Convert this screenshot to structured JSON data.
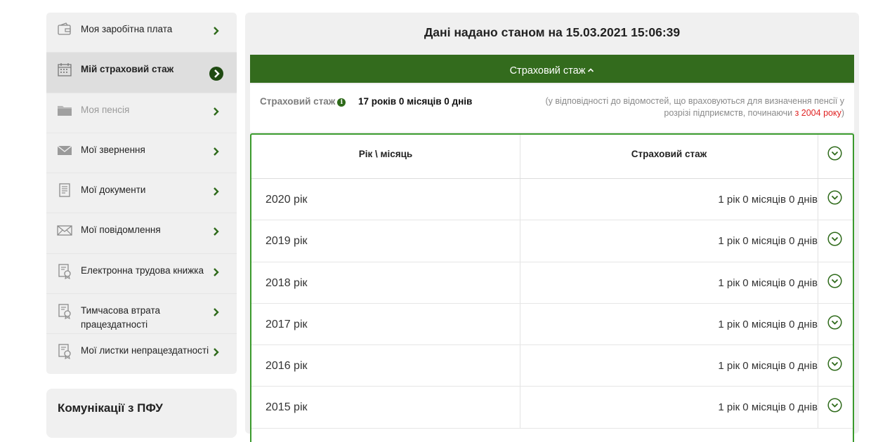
{
  "sidebar": {
    "items": [
      {
        "label": "Моя заробітна плата",
        "icon": "wallet-icon"
      },
      {
        "label": "Мій страховий стаж",
        "icon": "calendar-icon"
      },
      {
        "label": "Моя пенсія",
        "icon": "folder-icon"
      },
      {
        "label": "Мої звернення",
        "icon": "envelope-icon"
      },
      {
        "label": "Мої документи",
        "icon": "document-icon"
      },
      {
        "label": "Мої повідомлення",
        "icon": "mail-icon"
      },
      {
        "label": "Електронна трудова книжка",
        "icon": "certificate-icon"
      },
      {
        "label": "Тимчасова втрата працездатності",
        "icon": "certificate-icon"
      },
      {
        "label": "Мої листки непрацездатності",
        "icon": "certificate-icon"
      }
    ],
    "communications_title": "Комунікації з ПФУ"
  },
  "main": {
    "title": "Дані надано станом на 15.03.2021 15:06:39",
    "section_title": "Страховий стаж",
    "info": {
      "label": "Страховий стаж",
      "value": "17 років 0 місяців 0 днів",
      "note_prefix": "(у відповідності до відомостей, що враховуються для визначення пенсії у розрізі підприємств, починаючи",
      "note_highlight": "з 2004 року",
      "note_suffix": ")"
    },
    "table": {
      "headers": [
        "Рік \\ місяць",
        "Страховий стаж"
      ],
      "rows": [
        {
          "year": "2020 рік",
          "value": "1 рік 0 місяців 0 днів"
        },
        {
          "year": "2019 рік",
          "value": "1 рік 0 місяців 0 днів"
        },
        {
          "year": "2018 рік",
          "value": "1 рік 0 місяців 0 днів"
        },
        {
          "year": "2017 рік",
          "value": "1 рік 0 місяців 0 днів"
        },
        {
          "year": "2016 рік",
          "value": "1 рік 0 місяців 0 днів"
        },
        {
          "year": "2015 рік",
          "value": "1 рік 0 місяців 0 днів"
        }
      ]
    }
  },
  "colors": {
    "accent_green": "#336b1d",
    "table_border": "#3a9a2c",
    "highlight_red": "#e02323"
  }
}
